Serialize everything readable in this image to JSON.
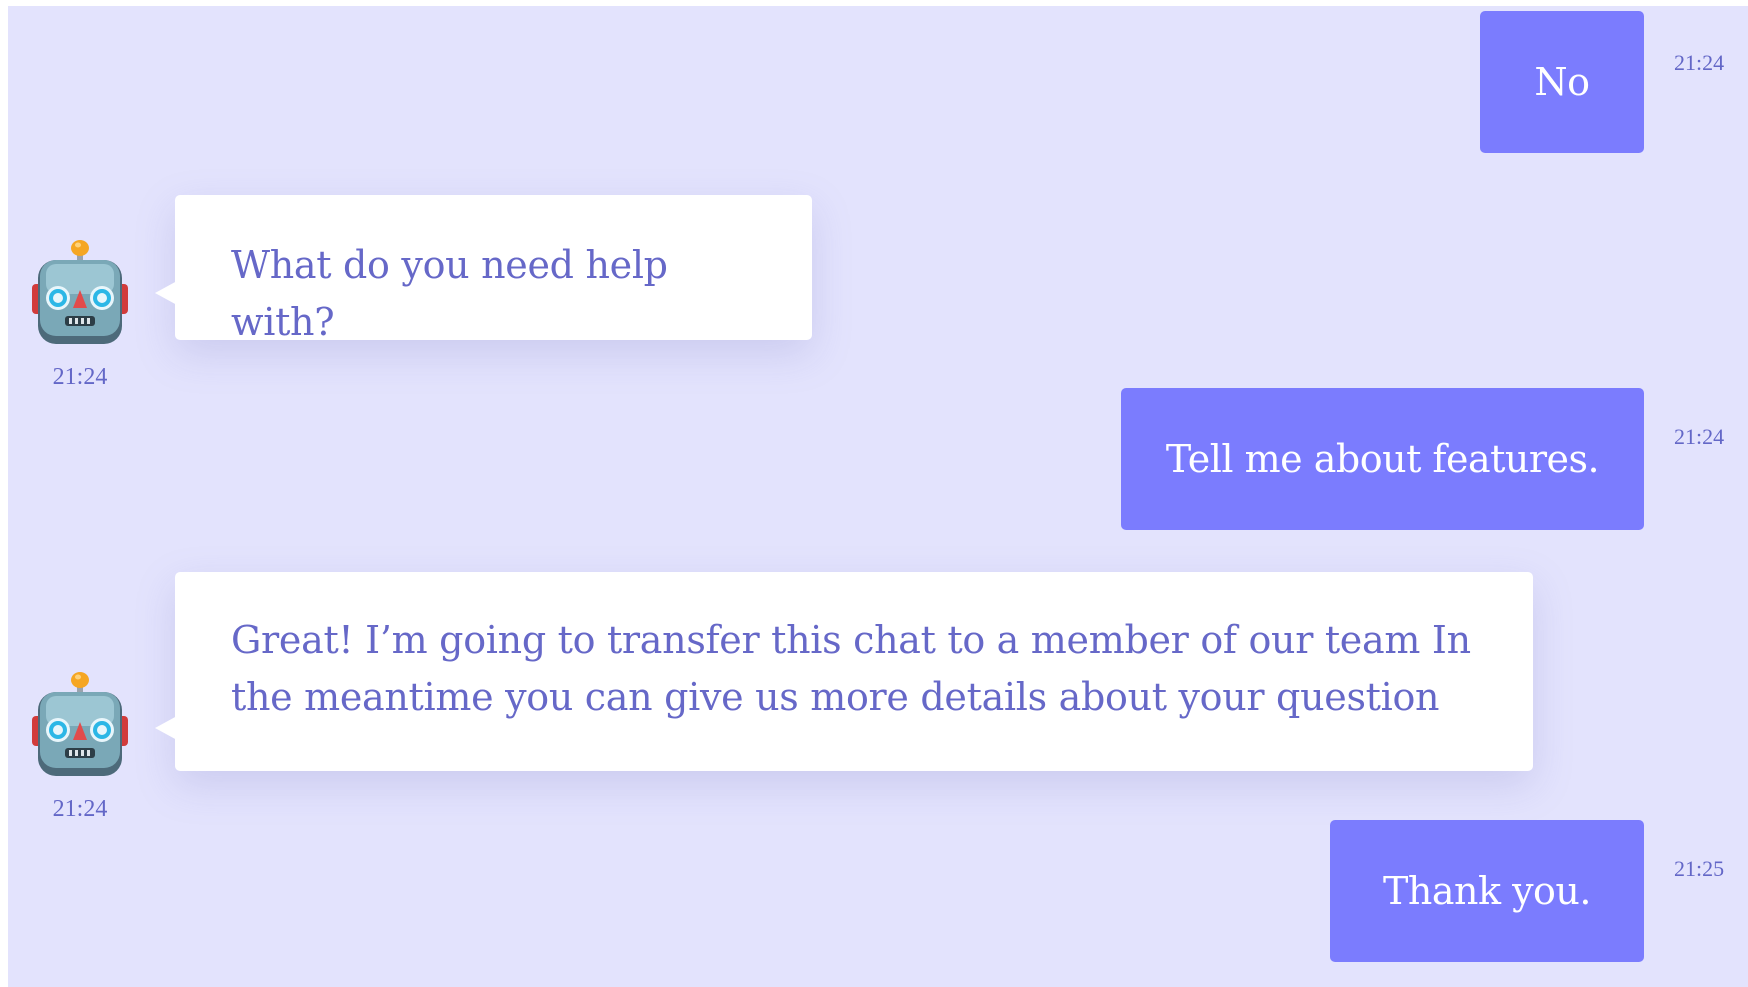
{
  "messages": [
    {
      "sender": "user",
      "text": "No",
      "time": "21:24"
    },
    {
      "sender": "bot",
      "text": "What do you need help with?",
      "time": "21:24",
      "avatar_icon": "robot-icon"
    },
    {
      "sender": "user",
      "text": "Tell me about features.",
      "time": "21:24"
    },
    {
      "sender": "bot",
      "text": "Great! I’m going to transfer this chat to a member of our team In the meantime you can give us more details about your question",
      "time": "21:24",
      "avatar_icon": "robot-icon"
    },
    {
      "sender": "user",
      "text": "Thank you.",
      "time": "21:25"
    }
  ],
  "colors": {
    "background": "#e3e3fd",
    "user_bubble": "#7b7cfe",
    "bot_text": "#6668c8",
    "timestamp": "#6367c7"
  }
}
